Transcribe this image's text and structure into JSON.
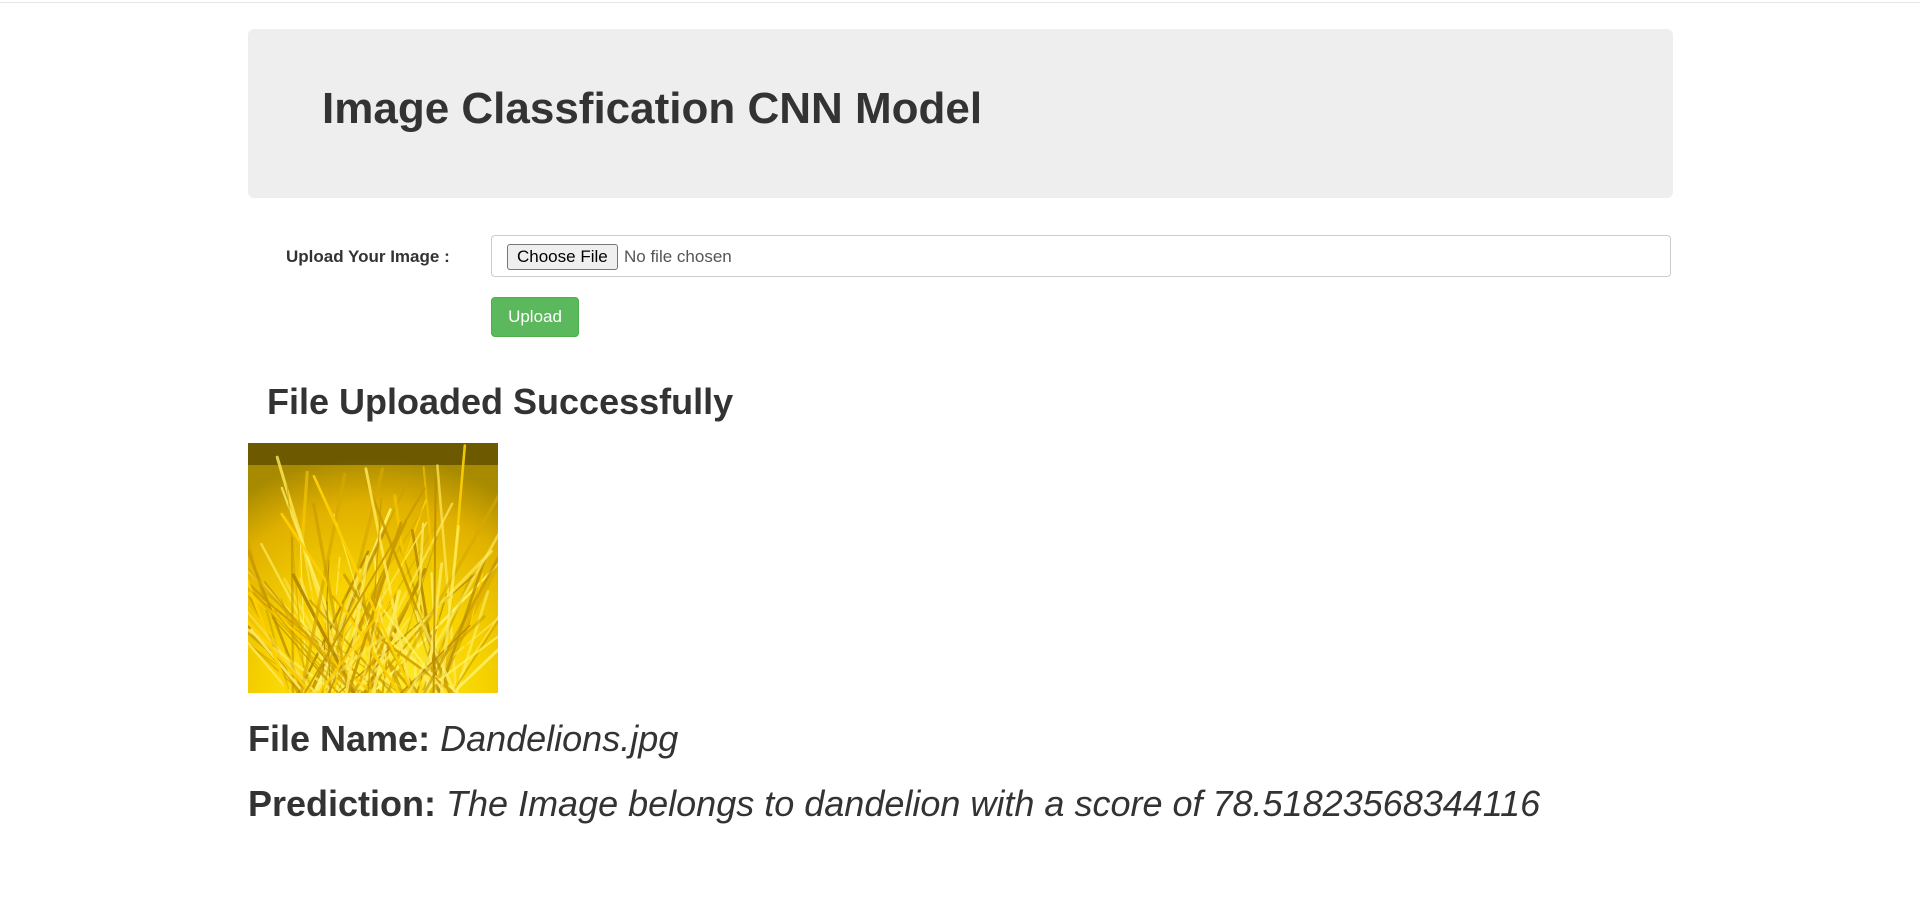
{
  "header": {
    "title": "Image Classfication CNN Model"
  },
  "form": {
    "label": "Upload Your Image :",
    "choose_button": "Choose File",
    "file_status": "No file chosen",
    "upload_button": "Upload"
  },
  "result": {
    "heading": "File Uploaded Successfully",
    "image_subject": "dandelion flower close-up",
    "file_name_label": "File Name:",
    "file_name_value": "Dandelions.jpg",
    "prediction_label": "Prediction:",
    "prediction_value": "The Image belongs to dandelion with a score of 78.51823568344116"
  },
  "colors": {
    "jumbotron_bg": "#eeeeee",
    "upload_button": "#5cb85c",
    "text": "#333333",
    "flower_yellow": "#f2c800"
  }
}
